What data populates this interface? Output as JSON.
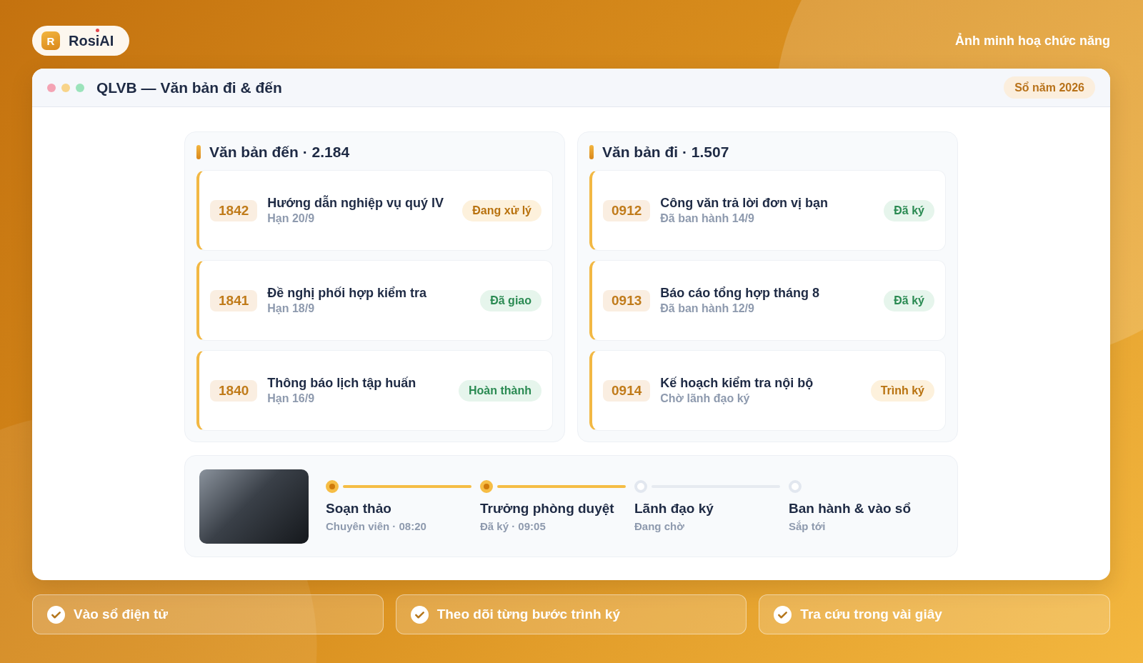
{
  "brand": {
    "mark": "R",
    "name": "RosiAI"
  },
  "caption": "Ảnh minh hoạ chức năng",
  "window": {
    "title": "QLVB — Văn bản đi & đến",
    "badge": "Sổ năm 2026"
  },
  "panels": [
    {
      "title": "Văn bản đến · 2.184",
      "documents": [
        {
          "number": "1842",
          "title": "Hướng dẫn nghiệp vụ quý IV",
          "subtitle": "Hạn 20/9",
          "status": {
            "label": "Đang xử lý",
            "kind": "pending"
          }
        },
        {
          "number": "1841",
          "title": "Đề nghị phối hợp kiểm tra",
          "subtitle": "Hạn 18/9",
          "status": {
            "label": "Đã giao",
            "kind": "done"
          }
        },
        {
          "number": "1840",
          "title": "Thông báo lịch tập huấn",
          "subtitle": "Hạn 16/9",
          "status": {
            "label": "Hoàn thành",
            "kind": "done"
          }
        }
      ]
    },
    {
      "title": "Văn bản đi · 1.507",
      "documents": [
        {
          "number": "0912",
          "title": "Công văn trả lời đơn vị bạn",
          "subtitle": "Đã ban hành 14/9",
          "status": {
            "label": "Đã ký",
            "kind": "done"
          }
        },
        {
          "number": "0913",
          "title": "Báo cáo tổng hợp tháng 8",
          "subtitle": "Đã ban hành 12/9",
          "status": {
            "label": "Đã ký",
            "kind": "done"
          }
        },
        {
          "number": "0914",
          "title": "Kế hoạch kiểm tra nội bộ",
          "subtitle": "Chờ lãnh đạo ký",
          "status": {
            "label": "Trình ký",
            "kind": "pending"
          }
        }
      ]
    }
  ],
  "workflow": {
    "steps": [
      {
        "label": "Soạn thảo",
        "detail": "Chuyên viên · 08:20",
        "done": true
      },
      {
        "label": "Trưởng phòng duyệt",
        "detail": "Đã ký · 09:05",
        "done": true
      },
      {
        "label": "Lãnh đạo ký",
        "detail": "Đang chờ",
        "done": false
      },
      {
        "label": "Ban hành & vào sổ",
        "detail": "Sắp tới",
        "done": false
      }
    ]
  },
  "features": [
    "Vào sổ điện tử",
    "Theo dõi từng bước trình ký",
    "Tra cứu trong vài giây"
  ]
}
